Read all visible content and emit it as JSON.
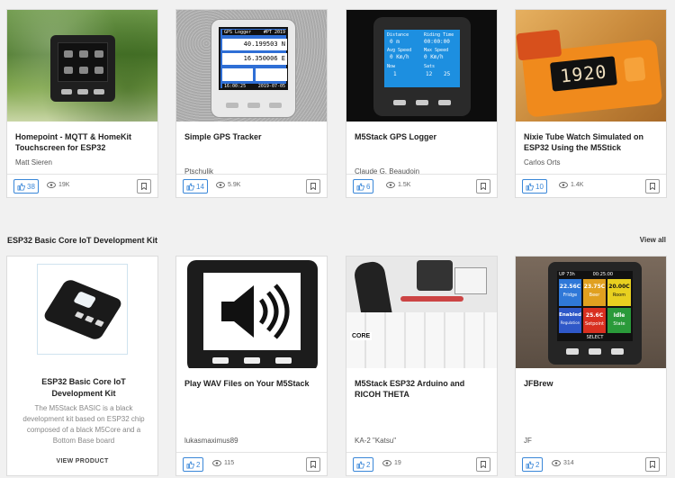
{
  "row1": [
    {
      "title": "Homepoint - MQTT & HomeKit Touchscreen for ESP32",
      "author": "Matt Sieren",
      "likes": "38",
      "views": "19K"
    },
    {
      "title": "Simple GPS Tracker",
      "author": "Ptschulik",
      "likes": "14",
      "views": "5.9K",
      "screen": {
        "header_left": "GPS Logger",
        "header_right": "#PT 2019",
        "line1": "40.199503 N",
        "line2": "16.350006 E",
        "foot_left": "16:00:25",
        "foot_right": "2019-07-05"
      }
    },
    {
      "title": "M5Stack GPS Logger",
      "author": "Claude G. Beaudoin",
      "likes": "6",
      "views": "1.5K",
      "screen": {
        "distance_label": "Distance",
        "distance_value": "0 m",
        "riding_label": "Riding Time",
        "riding_value": "00:00:00",
        "speed_label": "Avg Speed",
        "speed_value": "0 Km/h",
        "max_label": "Max Speed",
        "max_value": "0 Km/h",
        "now_label": "Now",
        "now_value": "1",
        "sats_label": "Sats",
        "sats_value": "12",
        "extra_value": "25"
      }
    },
    {
      "title": "Nixie Tube Watch Simulated on ESP32 Using the M5Stick",
      "author": "Carlos Orts",
      "likes": "10",
      "views": "1.4K",
      "digits": "1920"
    }
  ],
  "section": {
    "title": "ESP32 Basic Core IoT Development Kit",
    "view_all": "View all"
  },
  "product": {
    "title": "ESP32 Basic Core IoT Development Kit",
    "description": "The M5Stack BASIC is a black development kit based on ESP32 chip composed of a black M5Core and a Bottom Base board",
    "cta": "VIEW PRODUCT"
  },
  "row2": [
    {
      "title": "Play WAV Files on Your M5Stack",
      "author": "lukasmaximus89",
      "likes": "2",
      "views": "115"
    },
    {
      "title": "M5Stack ESP32 Arduino and RICOH THETA",
      "author": "KA-2 \"Katsu\"",
      "likes": "2",
      "views": "19",
      "box_label": "CORE"
    },
    {
      "title": "JFBrew",
      "author": "JF",
      "likes": "2",
      "views": "314",
      "screen": {
        "top_left": "UP 73h",
        "top_mid": "00:25:00",
        "cells": [
          "22.56C",
          "23.75C",
          "20.00C",
          "Fridge",
          "Beer",
          "Room",
          "Enabled",
          "25.6C",
          "Idle",
          "Regulation",
          "Setpoint",
          "State"
        ],
        "bottom": "SELECT"
      }
    }
  ],
  "colors": {
    "accent": "#3a87d8",
    "screen_blue": "#2f6fd6"
  }
}
